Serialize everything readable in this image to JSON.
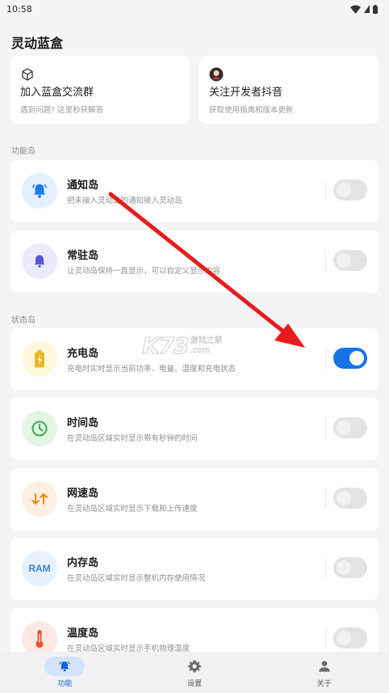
{
  "status_bar": {
    "time": "10:58"
  },
  "app": {
    "title": "灵动蓝盒"
  },
  "top_cards": [
    {
      "title": "加入蓝盒交流群",
      "subtitle": "遇到问题? 这里秒获解答",
      "icon": "cube-icon"
    },
    {
      "title": "关注开发者抖音",
      "subtitle": "获取使用指南和版本更新",
      "icon": "avatar-icon"
    }
  ],
  "sections": {
    "function": "功能岛",
    "status": "状态岛"
  },
  "items": [
    {
      "title": "通知岛",
      "desc": "把未接入灵动岛的通知接入灵动岛",
      "icon": "bell-icon",
      "icon_bg": "#e3efff",
      "icon_color": "#1e7ce8",
      "enabled": false
    },
    {
      "title": "常驻岛",
      "desc": "让灵动岛保持一直显示，可以自定义显示内容",
      "icon": "bell-icon",
      "icon_bg": "#ebeafd",
      "icon_color": "#5b55d8",
      "enabled": false
    },
    {
      "title": "充电岛",
      "desc": "充电时实时显示当前功率、电量、温度和充电状态",
      "icon": "battery-icon",
      "icon_bg": "#fdf7dc",
      "icon_color": "#e8b923",
      "enabled": true
    },
    {
      "title": "时间岛",
      "desc": "在灵动岛区域实时显示带有秒钟的时间",
      "icon": "clock-icon",
      "icon_bg": "#e4f5e6",
      "icon_color": "#3aae52",
      "enabled": false
    },
    {
      "title": "网速岛",
      "desc": "在灵动岛区域实时显示下载和上传速度",
      "icon": "updown-arrows-icon",
      "icon_bg": "#fdf0e2",
      "icon_color": "#e68a1f",
      "enabled": false
    },
    {
      "title": "内存岛",
      "desc": "在灵动岛区域实时显示整机内存使用情况",
      "icon": "ram-icon",
      "icon_text": "RAM",
      "icon_bg": "#e7f0fb",
      "icon_color": "#3f7fc9",
      "enabled": false
    },
    {
      "title": "温度岛",
      "desc": "在灵动岛区域实时显示手机物理温度",
      "icon": "thermometer-icon",
      "icon_bg": "#fde8e3",
      "icon_color": "#e5512f",
      "enabled": false
    }
  ],
  "watermark": {
    "main": "K73",
    "line1": "游戏之家",
    "line2": ".com"
  },
  "bottom_nav": [
    {
      "label": "功能",
      "icon": "bell-icon",
      "active": true
    },
    {
      "label": "设置",
      "icon": "gear-icon",
      "active": false
    },
    {
      "label": "关于",
      "icon": "person-icon",
      "active": false
    }
  ],
  "colors": {
    "accent": "#1774e8",
    "arrow": "#e81c1c"
  }
}
